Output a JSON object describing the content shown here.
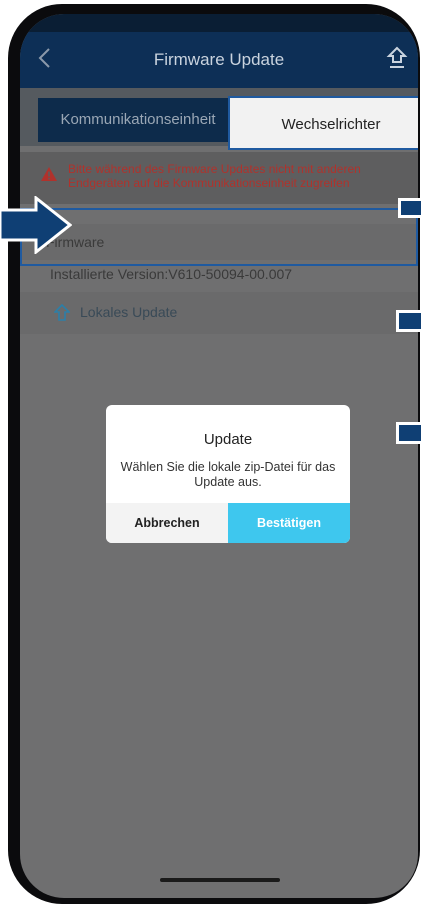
{
  "header": {
    "title": "Firmware Update"
  },
  "tabs": [
    {
      "label": "Kommunikationseinheit"
    },
    {
      "label": "Wechselrichter"
    }
  ],
  "warning": {
    "text": "Bitte während des Firmware Updates nicht mit anderen Endgeräten auf die Kommunikationseinheit zugreifen"
  },
  "firmware": {
    "section_label": "Firmware",
    "installed_version": "Installierte Version:V610-50094-00.007"
  },
  "local_update": {
    "label": "Lokales Update"
  },
  "dialog": {
    "title": "Update",
    "message": "Wählen Sie die lokale zip-Datei für das Update aus.",
    "cancel_label": "Abbrechen",
    "confirm_label": "Bestätigen"
  },
  "colors": {
    "appbar": "#0d2f56",
    "confirm": "#3ec7ee",
    "warning_text": "#b0322c",
    "callout": "#0f3f74"
  }
}
